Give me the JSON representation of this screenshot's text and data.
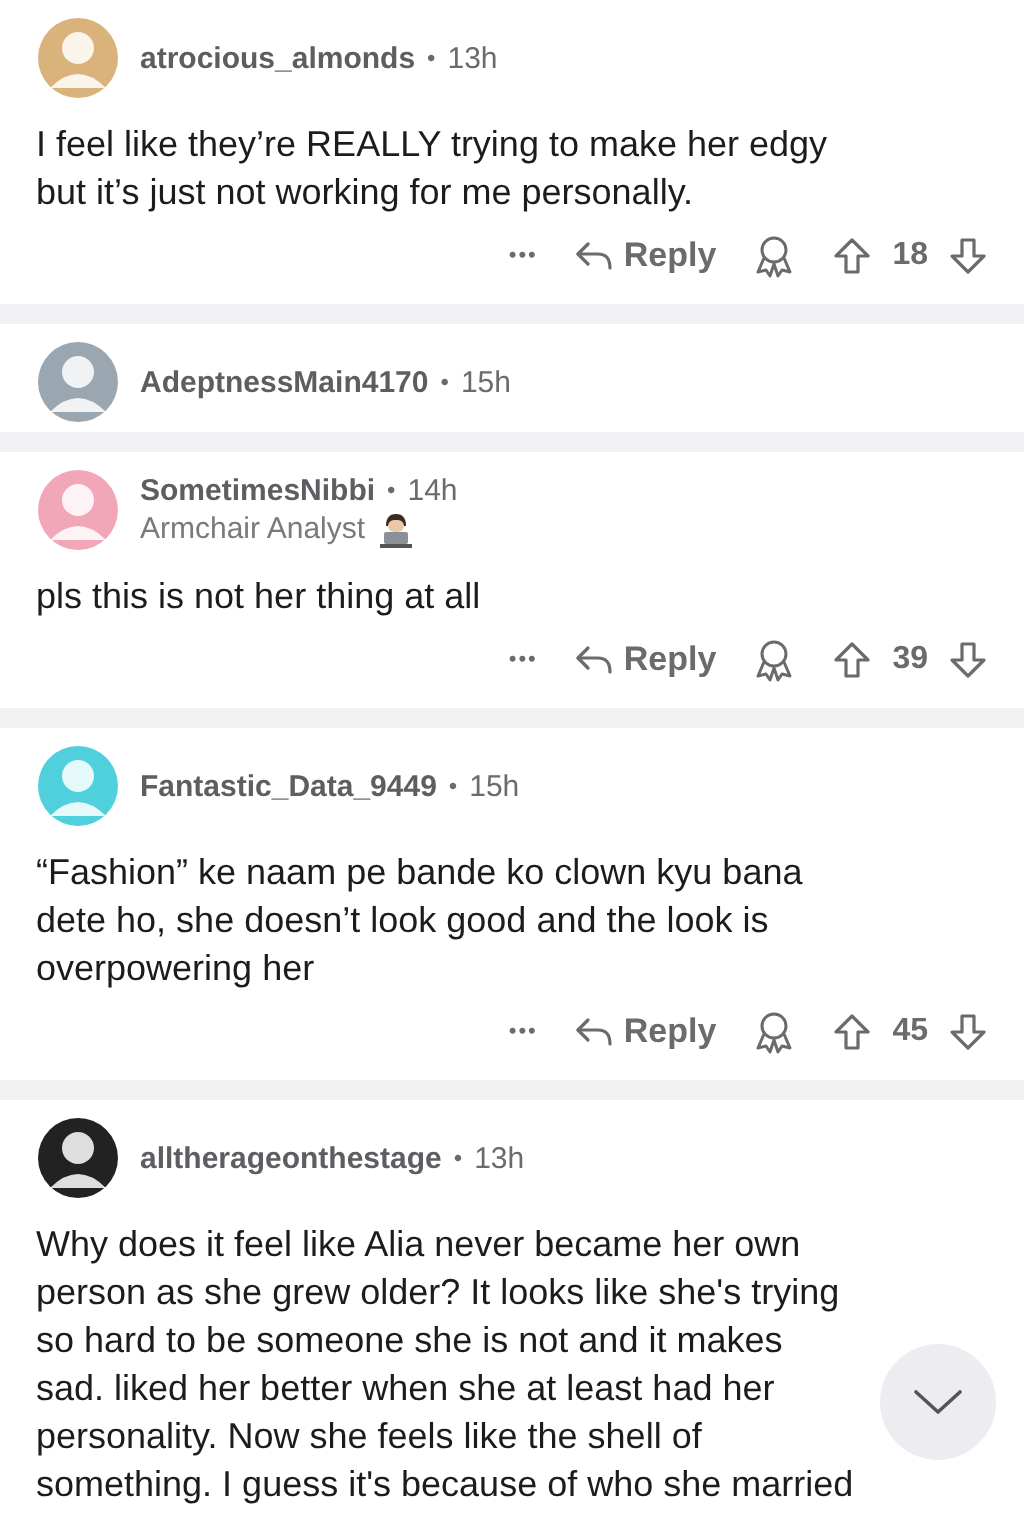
{
  "comments": [
    {
      "username": "atrocious_almonds",
      "dot": "•",
      "time": "13h",
      "avatar": {
        "color": "#d9b27c"
      },
      "lines": [
        "I feel like they’re REALLY trying to make her edgy",
        "but it’s just not working for me personally."
      ],
      "actions": {
        "more": "•••",
        "reply": "Reply",
        "score": "18"
      }
    },
    {
      "username": "AdeptnessMain4170",
      "dot": "•",
      "time": "15h",
      "avatar": {
        "color": "#9aa7b0"
      }
    },
    {
      "username": "SometimesNibbi",
      "dot": "•",
      "time": "14h",
      "flair": "Armchair Analyst",
      "avatar": {
        "color": "#f2a7b8"
      },
      "lines": [
        "pls this is not her thing at all"
      ],
      "actions": {
        "more": "•••",
        "reply": "Reply",
        "score": "39"
      }
    },
    {
      "username": "Fantastic_Data_9449",
      "dot": "•",
      "time": "15h",
      "avatar": {
        "color": "#4fd0dc"
      },
      "lines": [
        "“Fashion” ke naam pe bande ko clown kyu bana",
        "dete ho, she doesn’t look good and the look is",
        "overpowering her"
      ],
      "actions": {
        "more": "•••",
        "reply": "Reply",
        "score": "45"
      }
    },
    {
      "username": "alltherageonthestage",
      "dot": "•",
      "time": "13h",
      "avatar": {
        "color": "#222222"
      },
      "lines": [
        "Why does it feel like Alia never became her own",
        "person as she grew older? It looks like she's trying",
        "so hard to be someone she is not and it makes",
        "sad. liked her better when she at least had her",
        "personality. Now she feels like the shell of",
        "something. I guess it's because of who she married"
      ]
    }
  ]
}
